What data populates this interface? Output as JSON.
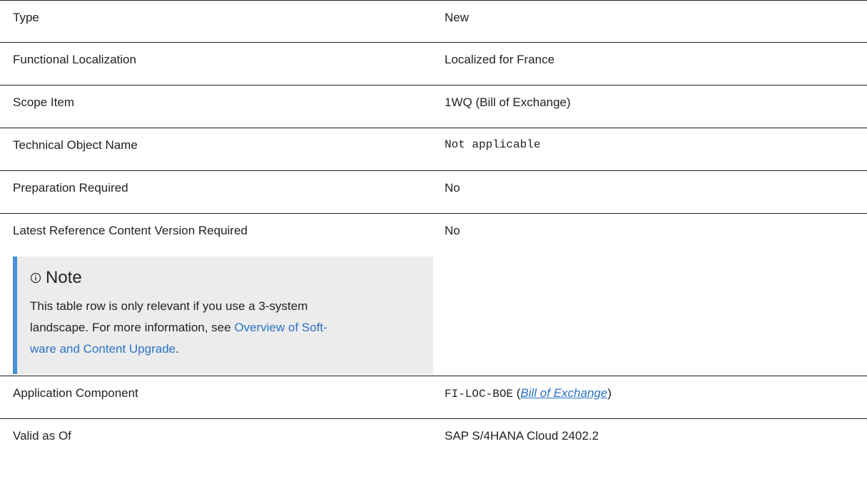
{
  "rows": [
    {
      "label": "Type",
      "value": "New"
    },
    {
      "label": "Functional Localization",
      "value": "Localized for France"
    },
    {
      "label": "Scope Item",
      "value": "1WQ (Bill of Exchange)"
    },
    {
      "label": "Technical Object Name",
      "value": "Not applicable"
    },
    {
      "label": "Preparation Required",
      "value": "No"
    },
    {
      "label": "Latest Reference Content Version Required",
      "value": "No"
    },
    {
      "label": "Application Component",
      "value_code": "FI-LOC-BOE",
      "value_open": " (",
      "value_link": "Bill of Exchange",
      "value_close": ")"
    },
    {
      "label": "Valid as Of",
      "value": "SAP S/4HANA Cloud 2402.2"
    }
  ],
  "note": {
    "icon": "info-icon",
    "title": "Note",
    "body_line1": "This table row is only relevant if you use a 3-system",
    "body_line2_prefix": "landscape. For more information, see ",
    "link_part1": "Overview of Soft-",
    "link_part2": "ware and Content Upgrade",
    "suffix": "."
  }
}
